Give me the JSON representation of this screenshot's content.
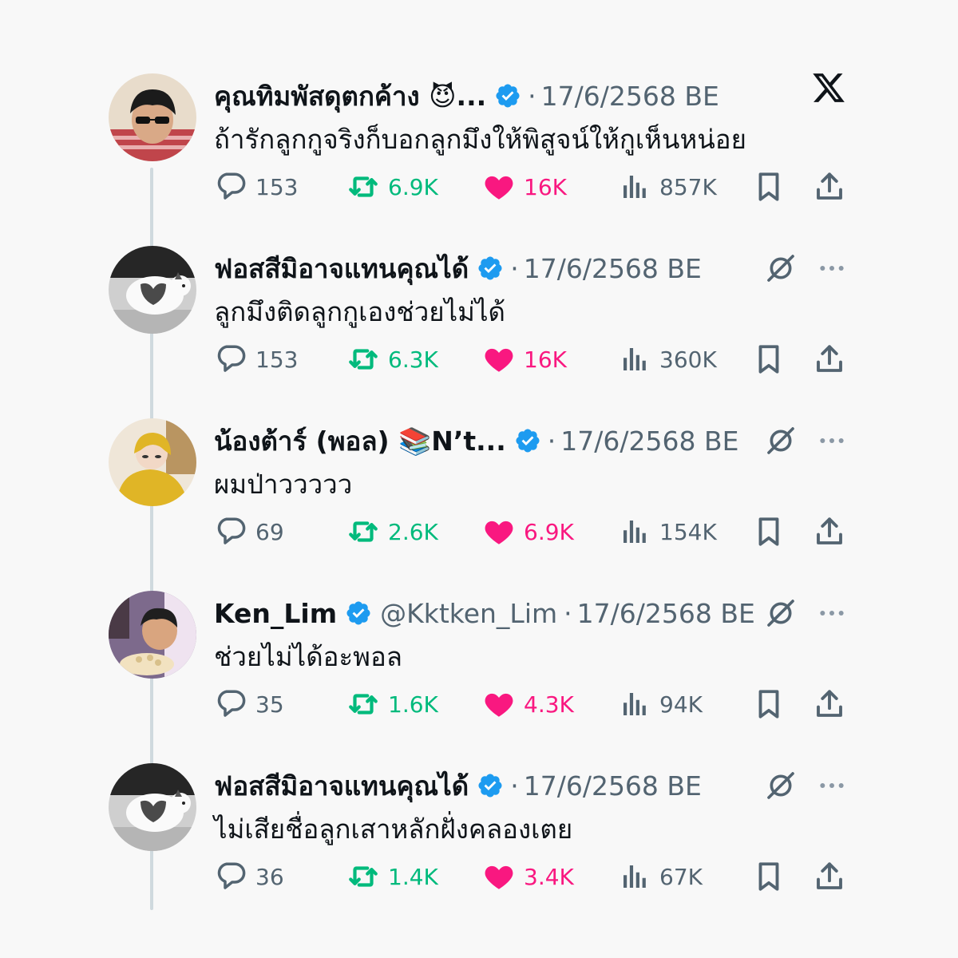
{
  "tweets": [
    {
      "name": "คุณทิมพัสดุตกค้าง 😈...",
      "handle": "",
      "time": "17/6/2568 BE",
      "text": "ถ้ารักลูกกูจริงก็บอกลูกมึงให้พิสูจน์ให้กูเห็นหน่อย",
      "replies": "153",
      "retweets": "6.9K",
      "likes": "16K",
      "views": "857K",
      "show_grok": false
    },
    {
      "name": "ฟอสสีมิอาจแทนคุณได้",
      "handle": "",
      "time": "17/6/2568 BE",
      "text": "ลูกมึงติดลูกกูเองช่วยไม่ได้",
      "replies": "153",
      "retweets": "6.3K",
      "likes": "16K",
      "views": "360K",
      "show_grok": true
    },
    {
      "name": "น้องต้าร์ (พอล) 📚N’t...",
      "handle": "",
      "time": "17/6/2568 BE",
      "text": "ผมป่าววววว",
      "replies": "69",
      "retweets": "2.6K",
      "likes": "6.9K",
      "views": "154K",
      "show_grok": true
    },
    {
      "name": "Ken_Lim",
      "handle": "@Kktken_Lim",
      "time": "17/6/2568 BE",
      "text": "ช่วยไม่ได้อะพอล",
      "replies": "35",
      "retweets": "1.6K",
      "likes": "4.3K",
      "views": "94K",
      "show_grok": true
    },
    {
      "name": "ฟอสสีมิอาจแทนคุณได้",
      "handle": "",
      "time": "17/6/2568 BE",
      "text": "ไม่เสียชื่อลูกเสาหลักฝั่งคลองเตย",
      "replies": "36",
      "retweets": "1.4K",
      "likes": "3.4K",
      "views": "67K",
      "show_grok": true
    }
  ],
  "separator": "·",
  "colors": {
    "text": "#0f1419",
    "muted": "#536471",
    "retweet": "#00ba7c",
    "like": "#f91880",
    "verified": "#1d9bf0",
    "thread_line": "#cfd9de",
    "background": "#f8f8f8"
  },
  "icons": {
    "brand": "x-logo-icon",
    "verified": "verified-badge-icon",
    "grok": "grok-icon",
    "more": "more-icon",
    "reply": "reply-icon",
    "retweet": "retweet-icon",
    "like": "heart-icon",
    "views": "views-icon",
    "bookmark": "bookmark-icon",
    "share": "share-icon"
  }
}
